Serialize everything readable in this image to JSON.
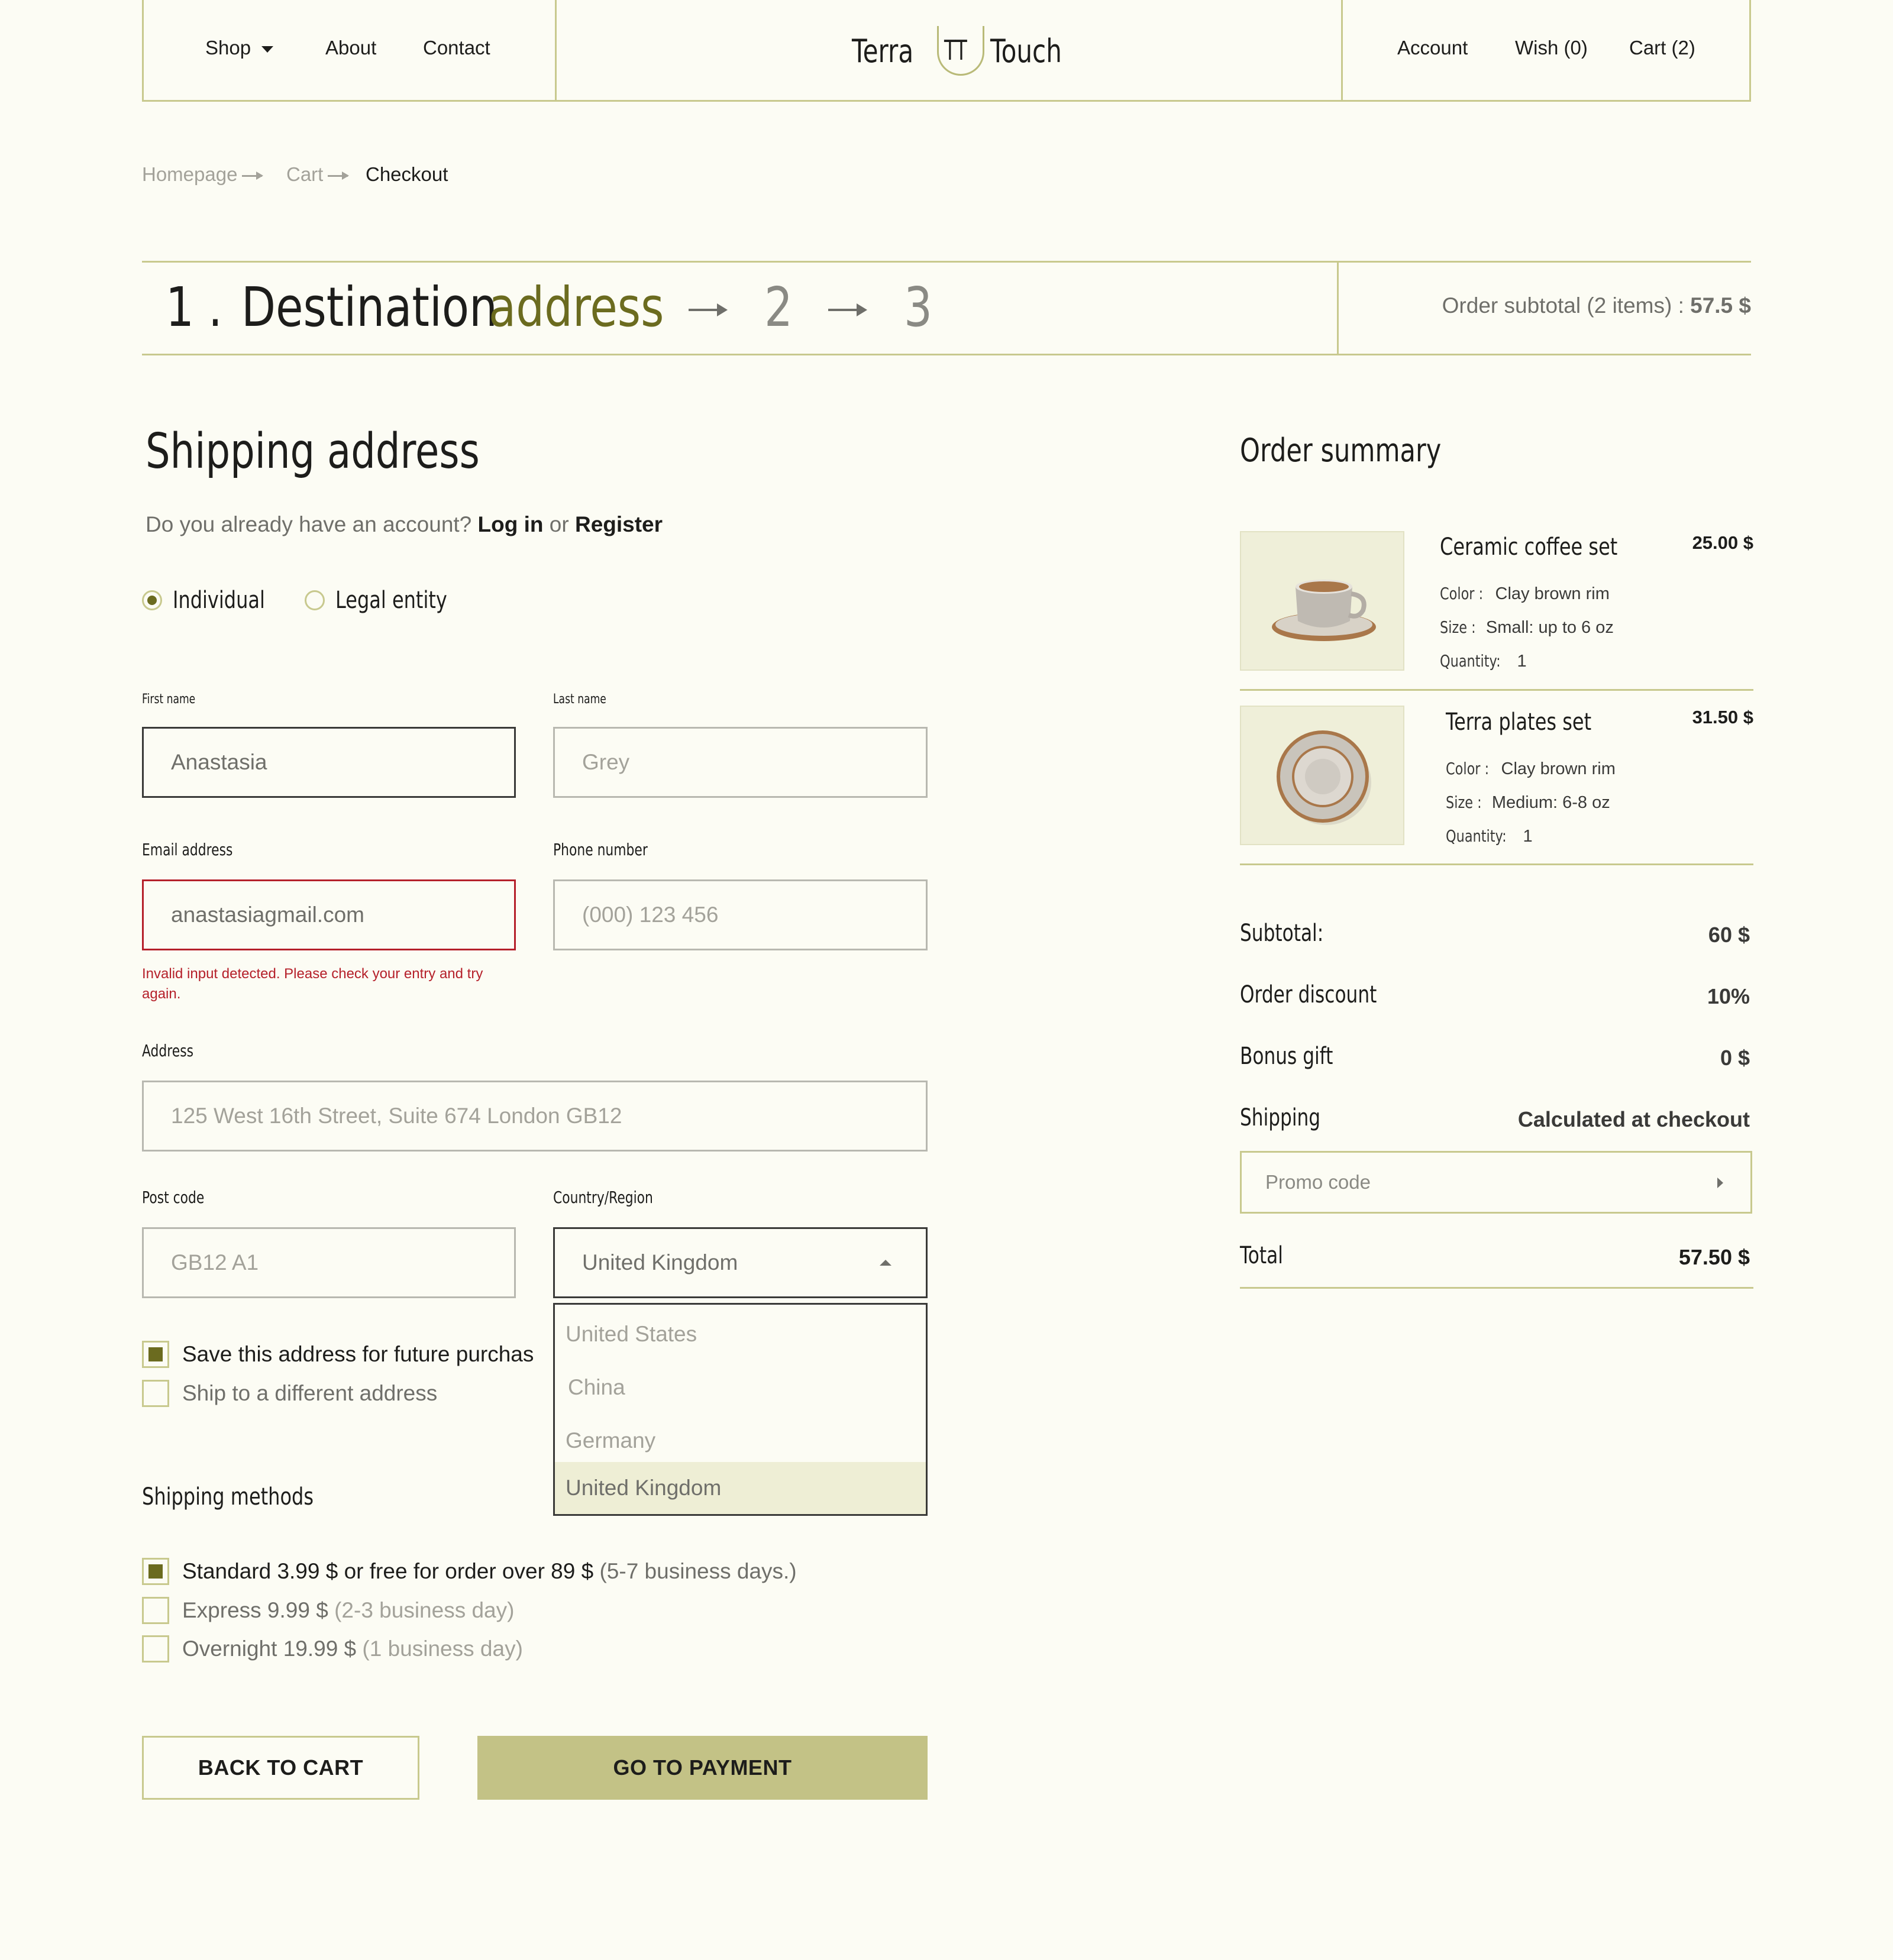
{
  "header": {
    "nav_left": [
      "Shop",
      "About",
      "Contact"
    ],
    "logo_left": "Terra",
    "logo_mark": "TT",
    "logo_right": "Touch",
    "nav_right": [
      "Account",
      "Wish (0)",
      "Cart (2)"
    ]
  },
  "breadcrumb": [
    "Homepage",
    "Cart",
    "Checkout"
  ],
  "steps": {
    "current_num": "1 .",
    "title_a": "Destination",
    "title_b": "address",
    "step2": "2",
    "step3": "3",
    "subtotal_label": "Order subtotal (2 items) :",
    "subtotal_value": "57.5 $"
  },
  "form": {
    "title": "Shipping address",
    "account_question": "Do you already have an account?",
    "login": "Log in",
    "or": "or",
    "register": "Register",
    "customer_types": [
      "Individual",
      "Legal entity"
    ],
    "customer_type_selected": "Individual",
    "first_name_label": "First name",
    "first_name_value": "Anastasia",
    "last_name_label": "Last name",
    "last_name_placeholder": "Grey",
    "email_label": "Email address",
    "email_value": "anastasiagmail.com",
    "email_error": "Invalid input detected. Please check your entry and try again.",
    "phone_label": "Phone number",
    "phone_placeholder": "(000) 123 456",
    "address_label": "Address",
    "address_placeholder": "125 West 16th Street, Suite 674 London GB12",
    "postcode_label": "Post code",
    "postcode_placeholder": "GB12 A1",
    "country_label": "Country/Region",
    "country_value": "United Kingdom",
    "country_options": [
      "United States",
      "China",
      "Germany",
      "United Kingdom"
    ],
    "save_address": "Save this address for future purchas",
    "save_address_checked": true,
    "ship_different": "Ship to a different address",
    "ship_different_checked": false
  },
  "shipping_methods": {
    "title": "Shipping methods",
    "options": [
      {
        "name": "Standard 3.99 $ or free for order over 89 $",
        "detail": "(5-7 business days.)",
        "checked": true
      },
      {
        "name": "Express 9.99 $",
        "detail": "(2-3 business day)",
        "checked": false
      },
      {
        "name": "Overnight 19.99 $",
        "detail": "(1 business day)",
        "checked": false
      }
    ]
  },
  "buttons": {
    "back": "BACK TO CART",
    "pay": "GO TO PAYMENT"
  },
  "summary": {
    "title": "Order summary",
    "items": [
      {
        "name": "Ceramic coffee set",
        "price": "25.00 $",
        "color_label": "Color :",
        "color": "Clay brown rim",
        "size_label": "Size :",
        "size": "Small: up to 6 oz",
        "qty_label": "Quantity:",
        "qty": "1"
      },
      {
        "name": "Terra plates set",
        "price": "31.50 $",
        "color_label": "Color :",
        "color": "Clay brown rim",
        "size_label": "Size :",
        "size": "Medium: 6-8 oz",
        "qty_label": "Quantity:",
        "qty": "1"
      }
    ],
    "subtotal_label": "Subtotal:",
    "subtotal_value": "60 $",
    "discount_label": "Order discount",
    "discount_value": "10%",
    "gift_label": "Bonus gift",
    "gift_value": "0 $",
    "shipping_label": "Shipping",
    "shipping_value": "Calculated at checkout",
    "promo_placeholder": "Promo code",
    "total_label": "Total",
    "total_value": "57.50 $"
  },
  "colors": {
    "accent": "#6b6b1f",
    "accent_text": "#6b6b1f",
    "border": "#c8c98e",
    "button": "#c3c286",
    "error": "#b5202a",
    "background": "#fcfcf4"
  }
}
